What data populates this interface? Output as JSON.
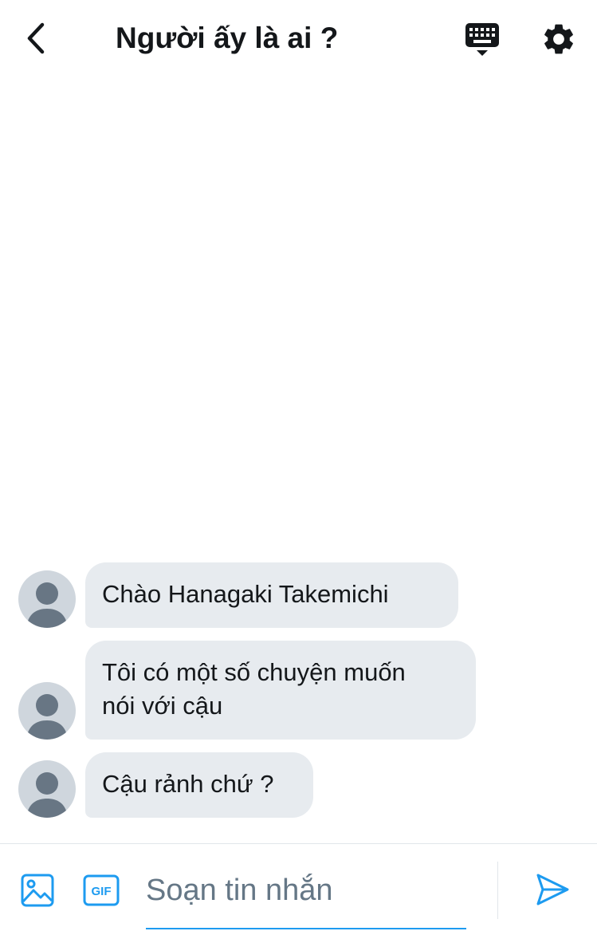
{
  "header": {
    "title": "Người ấy là ai ?"
  },
  "messages": [
    {
      "lines": [
        "Chào Hanagaki Takemichi"
      ]
    },
    {
      "lines": [
        "Tôi có một số chuyện muốn",
        "nói với cậu"
      ]
    },
    {
      "lines": [
        "Cậu rảnh chứ ?"
      ]
    }
  ],
  "composer": {
    "placeholder": "Soạn tin nhắn",
    "gif_label": "GIF"
  },
  "colors": {
    "accent": "#1d9bf0",
    "bubble_bg": "#e7ebef",
    "avatar_bg": "#cfd6dd",
    "avatar_fg": "#687684"
  },
  "icons": {
    "back": "chevron-left-icon",
    "keyboard": "keyboard-icon",
    "settings": "gear-icon",
    "media": "image-icon",
    "gif": "gif-icon",
    "send": "send-icon"
  }
}
